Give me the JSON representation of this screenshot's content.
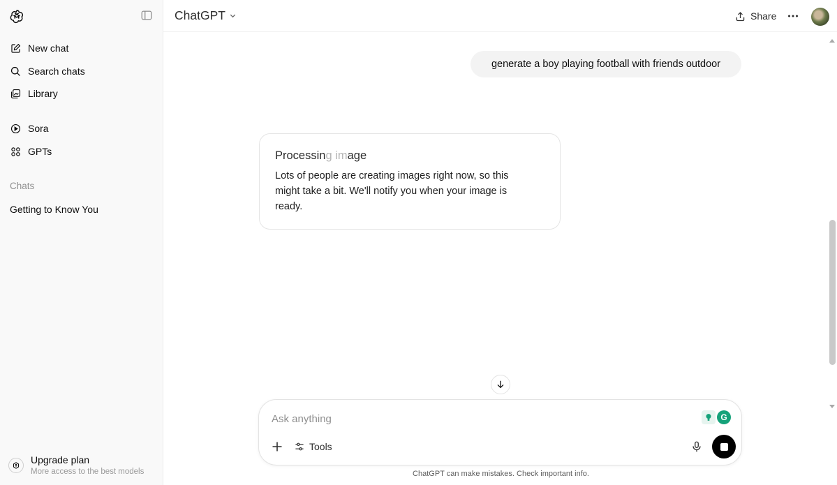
{
  "sidebar": {
    "nav": [
      {
        "label": "New chat",
        "icon": "new-chat-icon"
      },
      {
        "label": "Search chats",
        "icon": "search-icon"
      },
      {
        "label": "Library",
        "icon": "library-icon"
      },
      {
        "label": "Sora",
        "icon": "play-circle-icon"
      },
      {
        "label": "GPTs",
        "icon": "grid-icon"
      }
    ],
    "section_label": "Chats",
    "chats": [
      "Getting to Know You"
    ],
    "upgrade": {
      "title": "Upgrade plan",
      "subtitle": "More access to the best models"
    }
  },
  "header": {
    "model_name": "ChatGPT",
    "share_label": "Share"
  },
  "conversation": {
    "user_message": "generate a boy playing football with friends outdoor",
    "processing": {
      "title_main": "Processin",
      "title_faded": "g im",
      "title_end": "age",
      "body": "Lots of people are creating images right now, so this might take a bit. We'll notify you when your image is ready."
    }
  },
  "composer": {
    "placeholder": "Ask anything",
    "tools_label": "Tools",
    "extension_letter": "G"
  },
  "disclaimer": "ChatGPT can make mistakes. Check important info.",
  "colors": {
    "sidebar_bg": "#f9f9f9",
    "bubble_bg": "#f3f3f3",
    "send_stop_bg": "#000000",
    "extension_green": "#15a27a"
  }
}
